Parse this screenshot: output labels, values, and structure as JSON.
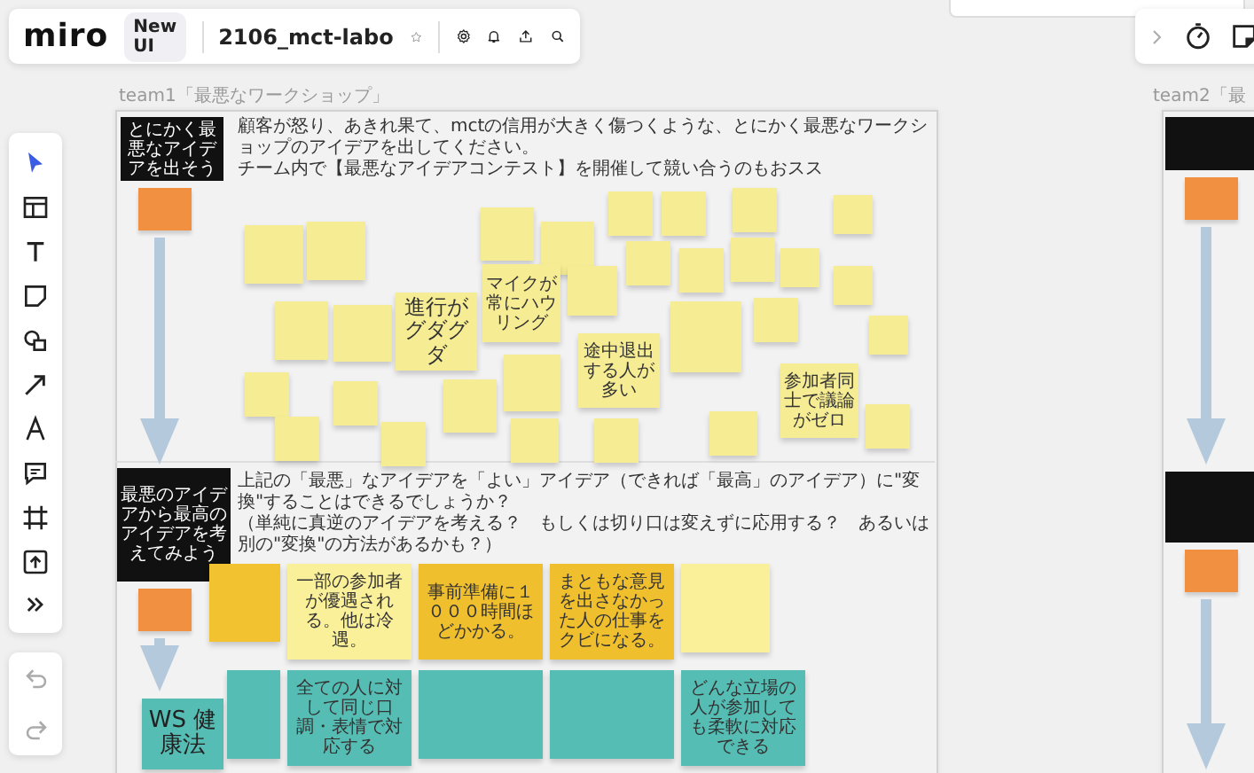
{
  "toolbar": {
    "logo": "miro",
    "badge": "New UI",
    "board_name": "2106_mct-labo"
  },
  "frames": [
    {
      "title": "team1「最悪なワークショップ」"
    },
    {
      "title": "team2「最"
    }
  ],
  "sections": [
    {
      "label": "とにかく最悪なアイデアを出そう",
      "prompt": [
        "顧客が怒り、あきれ果て、mctの信用が大きく傷つくような、とにかく最悪なワークショップのアイデアを出してください。",
        "チーム内で【最悪なアイデアコンテスト】を開催して競い合うのもおスス"
      ],
      "stickies": [
        {
          "color": "#f6ec94"
        },
        {
          "color": "#f6ec94"
        },
        {
          "color": "#f6ec94"
        },
        {
          "color": "#f6ec94"
        },
        {
          "color": "#f6ec94",
          "text": "進行がグダグダ"
        },
        {
          "color": "#f6ec94"
        },
        {
          "color": "#f6ec94"
        },
        {
          "color": "#f6ec94",
          "text": "マイクが常にハウリング"
        },
        {
          "color": "#f6ec94"
        },
        {
          "color": "#f6ec94"
        },
        {
          "color": "#f6ec94"
        },
        {
          "color": "#f6ec94"
        },
        {
          "color": "#f6ec94"
        },
        {
          "color": "#f6ec94"
        },
        {
          "color": "#f6ec94"
        },
        {
          "color": "#f6ec94"
        },
        {
          "color": "#f6ec94"
        },
        {
          "color": "#f6ec94"
        },
        {
          "color": "#f6ec94"
        },
        {
          "color": "#f6ec94"
        },
        {
          "color": "#f6ec94"
        },
        {
          "color": "#f6ec94",
          "text": "途中退出する人が多い"
        },
        {
          "color": "#f6ec94"
        },
        {
          "color": "#f6ec94"
        },
        {
          "color": "#f6ec94",
          "text": "参加者同士で議論がゼロ"
        },
        {
          "color": "#f6ec94"
        },
        {
          "color": "#f6ec94"
        },
        {
          "color": "#f6ec94"
        },
        {
          "color": "#f6ec94"
        },
        {
          "color": "#f6ec94"
        },
        {
          "color": "#f6ec94"
        },
        {
          "color": "#f6ec94"
        },
        {
          "color": "#f6ec94"
        }
      ]
    },
    {
      "label": "最悪のアイデアから最高のアイデアを考えてみよう",
      "prompt": [
        "上記の「最悪」なアイデアを「よい」アイデア（できれば「最高」のアイデア）に\"変換\"することはできるでしょうか？",
        "（単純に真逆のアイデアを考える？　もしくは切り口は変えずに応用する？　あるいは別の\"変換\"の方法があるかも？）"
      ],
      "stickies": [
        {
          "color": "#f2c230"
        },
        {
          "color": "#fbf09a",
          "text": "一部の参加者が優遇される。他は冷遇。"
        },
        {
          "color": "#efbf2e",
          "text": "事前準備に１０００時間ほどかかる。"
        },
        {
          "color": "#efbf2e",
          "text": "まともな意見を出さなかった人の仕事をクビになる。"
        },
        {
          "color": "#fbf09a"
        },
        {
          "color": "#55bdb3",
          "text": "WS 健康法"
        },
        {
          "color": "#55bdb3"
        },
        {
          "color": "#55bdb3",
          "text": "全ての人に対して同じ口調・表情で対応する"
        },
        {
          "color": "#55bdb3"
        },
        {
          "color": "#55bdb3"
        },
        {
          "color": "#55bdb3",
          "text": "どんな立場の人が参加しても柔軟に対応できる"
        }
      ]
    }
  ]
}
